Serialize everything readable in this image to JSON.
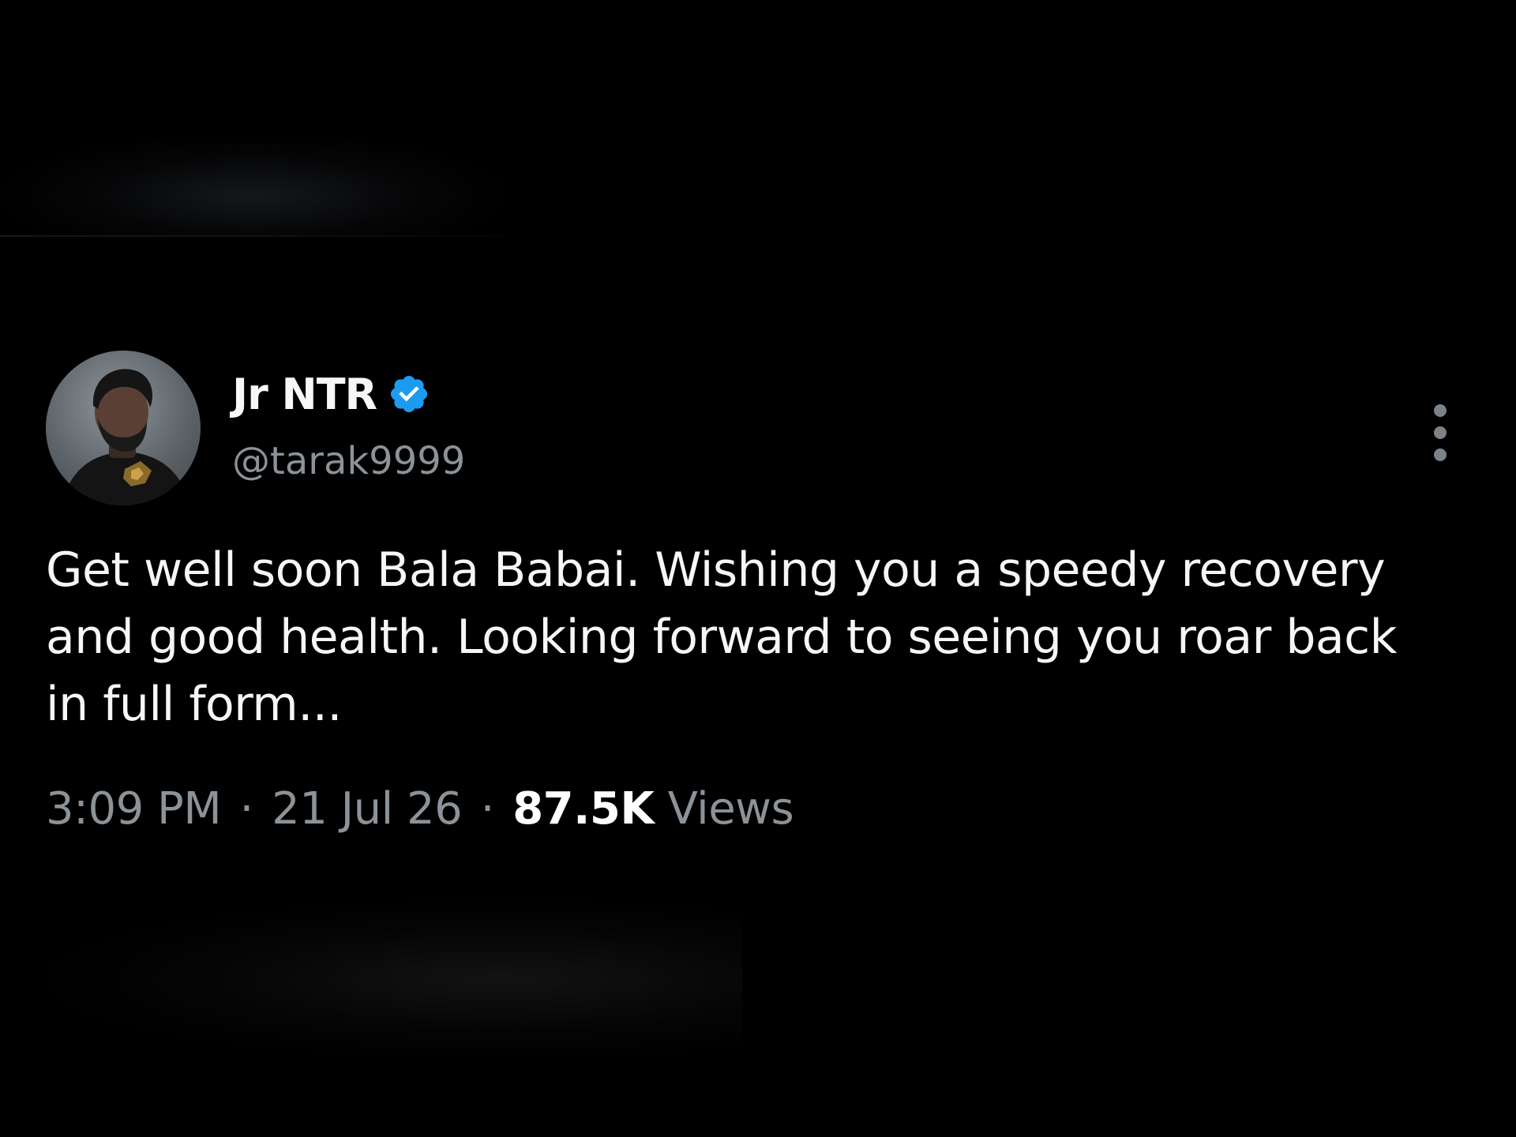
{
  "tweet": {
    "author": {
      "display_name": "Jr NTR",
      "handle": "@tarak9999",
      "verified": true,
      "avatar_icon": "profile-photo",
      "verified_badge_color": "#1d9bf0"
    },
    "text": "Get well soon Bala Babai. Wishing you a speedy recovery and good health. Looking forward to seeing you roar back in full form...",
    "meta": {
      "time": "3:09 PM",
      "separator": "·",
      "date": "21 Jul 26",
      "views_count": "87.5K",
      "views_label": "Views"
    },
    "more_icon": "more-vertical-icon"
  },
  "theme": {
    "background": "#000000",
    "text_primary": "#f4f6f7",
    "text_secondary": "#8b9298",
    "accent": "#1d9bf0"
  }
}
